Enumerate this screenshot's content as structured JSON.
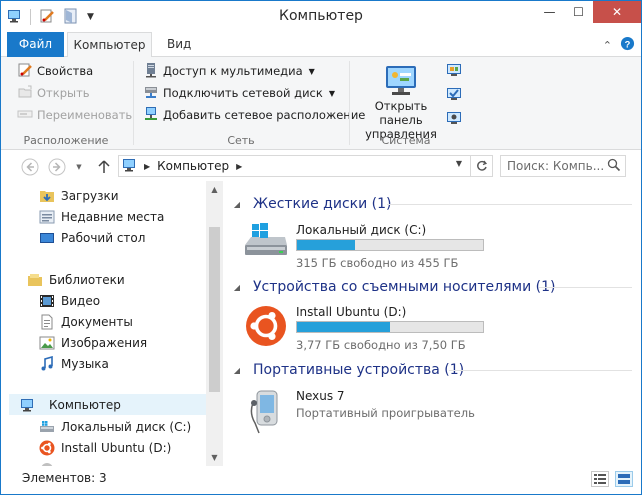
{
  "window": {
    "title": "Компьютер"
  },
  "title_buttons": {
    "minimize": "—",
    "maximize": "☐",
    "close": "✕"
  },
  "ribbon_tabs": {
    "file": "Файл",
    "computer": "Компьютер",
    "view": "Вид"
  },
  "ribbon": {
    "location": {
      "label": "Расположение",
      "properties": "Свойства",
      "open": "Открыть",
      "rename": "Переименовать"
    },
    "network": {
      "label": "Сеть",
      "media_access": "Доступ к мультимедиа",
      "map_drive": "Подключить сетевой диск",
      "add_location": "Добавить сетевое расположение"
    },
    "system": {
      "label": "Система",
      "control_panel_line1": "Открыть панель",
      "control_panel_line2": "управления"
    }
  },
  "address": {
    "path": "Компьютер",
    "search_placeholder": "Поиск: Компь..."
  },
  "nav_pane": {
    "downloads": "Загрузки",
    "recent": "Недавние места",
    "desktop": "Рабочий стол",
    "libraries": "Библиотеки",
    "video": "Видео",
    "documents": "Документы",
    "images": "Изображения",
    "music": "Музыка",
    "computer": "Компьютер",
    "local_disk": "Локальный диск (C:)",
    "ubuntu": "Install Ubuntu (D:)"
  },
  "content": {
    "hard_drives": {
      "heading": "Жесткие диски (1)",
      "items": [
        {
          "name": "Локальный диск (C:)",
          "free": "315 ГБ свободно из 455 ГБ",
          "used_fraction": 0.31
        }
      ]
    },
    "removable": {
      "heading": "Устройства со съемными носителями (1)",
      "items": [
        {
          "name": "Install Ubuntu (D:)",
          "free": "3,77 ГБ свободно из 7,50 ГБ",
          "used_fraction": 0.5
        }
      ]
    },
    "portable": {
      "heading": "Портативные устройства (1)",
      "items": [
        {
          "name": "Nexus 7",
          "type": "Портативный проигрыватель"
        }
      ]
    }
  },
  "status": {
    "count": "Элементов: 3"
  },
  "colors": {
    "accent": "#1979ca",
    "group_heading": "#1e3287",
    "progress": "#26a0da",
    "ribbon_bg": "#f5f6f7",
    "close_button": "#c7504a"
  }
}
